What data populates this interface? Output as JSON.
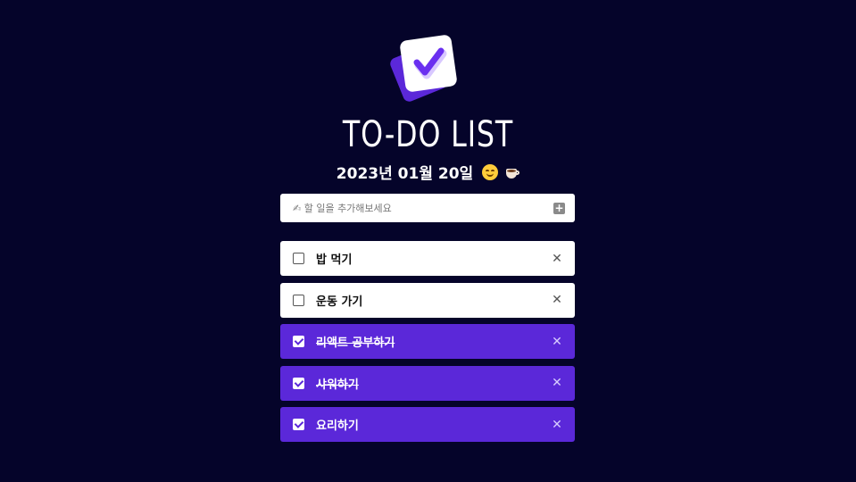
{
  "app": {
    "title": "TO-DO LIST",
    "date": "2023년 01월 20일",
    "date_emojis": [
      "smile-emoji",
      "coffee-emoji"
    ]
  },
  "add": {
    "placeholder": "✍ 할 일을 추가해보세요",
    "icon": "plus-icon"
  },
  "colors": {
    "background": "#05042a",
    "accent": "#5b28d9",
    "card": "#ffffff"
  },
  "todos": [
    {
      "label": "밥 먹기",
      "done": false
    },
    {
      "label": "운동 가기",
      "done": false
    },
    {
      "label": "리액트 공부하기",
      "done": true
    },
    {
      "label": "샤워하기",
      "done": true
    },
    {
      "label": "요리하기",
      "done": true
    }
  ],
  "delete_icon": "close-icon"
}
